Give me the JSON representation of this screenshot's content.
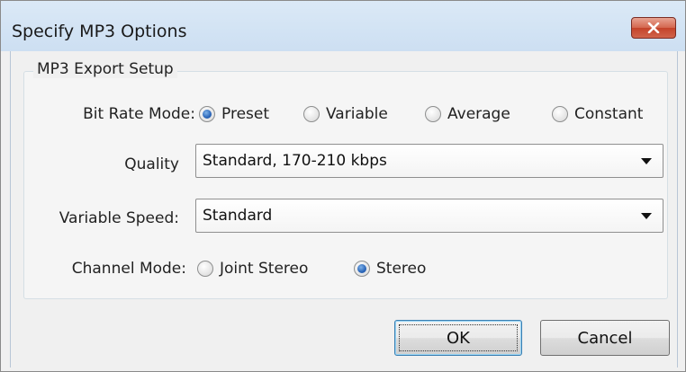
{
  "window": {
    "title": "Specify MP3 Options"
  },
  "group": {
    "legend": "MP3 Export Setup"
  },
  "bit_rate_mode": {
    "label": "Bit Rate Mode:",
    "options": [
      {
        "label": "Preset",
        "selected": true
      },
      {
        "label": "Variable",
        "selected": false
      },
      {
        "label": "Average",
        "selected": false
      },
      {
        "label": "Constant",
        "selected": false
      }
    ]
  },
  "quality": {
    "label": "Quality",
    "value": "Standard, 170-210 kbps"
  },
  "variable_speed": {
    "label": "Variable Speed:",
    "value": "Standard"
  },
  "channel_mode": {
    "label": "Channel Mode:",
    "options": [
      {
        "label": "Joint Stereo",
        "selected": false
      },
      {
        "label": "Stereo",
        "selected": true
      }
    ]
  },
  "buttons": {
    "ok": "OK",
    "cancel": "Cancel"
  },
  "icons": {
    "close": "close-icon",
    "dropdown": "chevron-down-icon"
  },
  "colors": {
    "titlebar": "#d2e3f4",
    "close_button": "#c4432a",
    "radio_selected": "#2a65b8"
  }
}
